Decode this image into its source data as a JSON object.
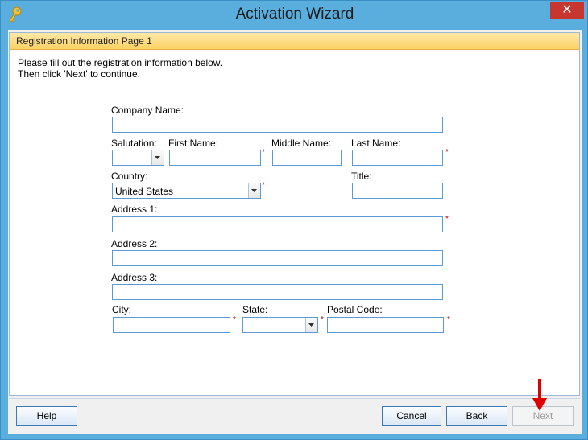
{
  "window": {
    "title": "Activation Wizard",
    "close_glyph": "✕"
  },
  "panel": {
    "header": "Registration Information Page 1",
    "instruction_1": "Please fill out the registration information below.",
    "instruction_2": "Then click 'Next' to continue."
  },
  "form": {
    "company_label": "Company Name:",
    "company_value": "",
    "salutation_label": "Salutation:",
    "salutation_value": "",
    "first_name_label": "First Name:",
    "first_name_value": "",
    "middle_name_label": "Middle Name:",
    "middle_name_value": "",
    "last_name_label": "Last Name:",
    "last_name_value": "",
    "country_label": "Country:",
    "country_value": "United States",
    "title_label": "Title:",
    "title_value": "",
    "address1_label": "Address 1:",
    "address1_value": "",
    "address2_label": "Address 2:",
    "address2_value": "",
    "address3_label": "Address 3:",
    "address3_value": "",
    "city_label": "City:",
    "city_value": "",
    "state_label": "State:",
    "state_value": "",
    "postal_label": "Postal Code:",
    "postal_value": "",
    "required_mark": "*"
  },
  "buttons": {
    "help": "Help",
    "cancel": "Cancel",
    "back": "Back",
    "next": "Next",
    "next_enabled": false
  },
  "colors": {
    "titlebar": "#5aaedd",
    "close": "#c7372f",
    "header_gradient_top": "#ffe9a8",
    "header_gradient_bottom": "#fbd163",
    "field_border": "#5b9bd5",
    "required": "#c00000",
    "annotation_arrow": "#e00000"
  },
  "icons": {
    "app": "key-icon",
    "close": "close-icon",
    "dropdown": "chevron-down-icon",
    "annotation": "red-arrow-down-icon"
  }
}
